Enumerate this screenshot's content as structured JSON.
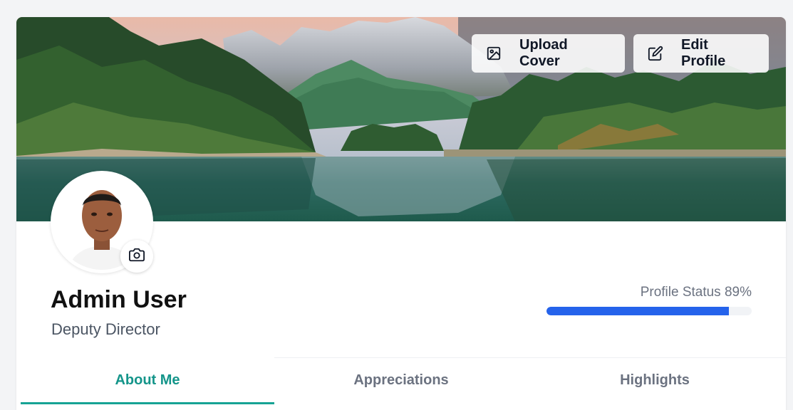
{
  "profile": {
    "name": "Admin User",
    "role": "Deputy Director"
  },
  "cover": {
    "upload_label": "Upload Cover",
    "edit_label": "Edit Profile"
  },
  "status": {
    "label": "Profile Status 89%",
    "percent": 89,
    "bar_color": "#2563eb"
  },
  "tabs": [
    {
      "label": "About Me",
      "active": true
    },
    {
      "label": "Appreciations",
      "active": false
    },
    {
      "label": "Highlights",
      "active": false
    }
  ],
  "colors": {
    "accent": "#14958a",
    "progress": "#2563eb"
  },
  "icons": {
    "upload": "image-icon",
    "edit": "edit-icon",
    "camera": "camera-icon"
  }
}
